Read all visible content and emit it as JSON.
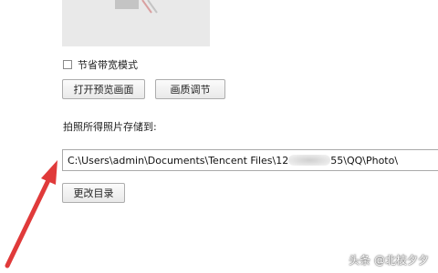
{
  "settings": {
    "save_bandwidth_label": "节省带宽模式",
    "open_preview_button": "打开预览画面",
    "quality_button": "画质调节",
    "save_location_label": "拍照所得照片存储到:",
    "path": {
      "prefix": "C:\\Users\\admin\\Documents\\Tencent Files\\12",
      "suffix": "55\\QQ\\Photo\\"
    },
    "change_dir_button": "更改目录"
  },
  "watermark": {
    "text": "头条 @北枝夕夕"
  },
  "colors": {
    "arrow": "#e03a3a",
    "preview_bg": "#e9e9e9"
  }
}
